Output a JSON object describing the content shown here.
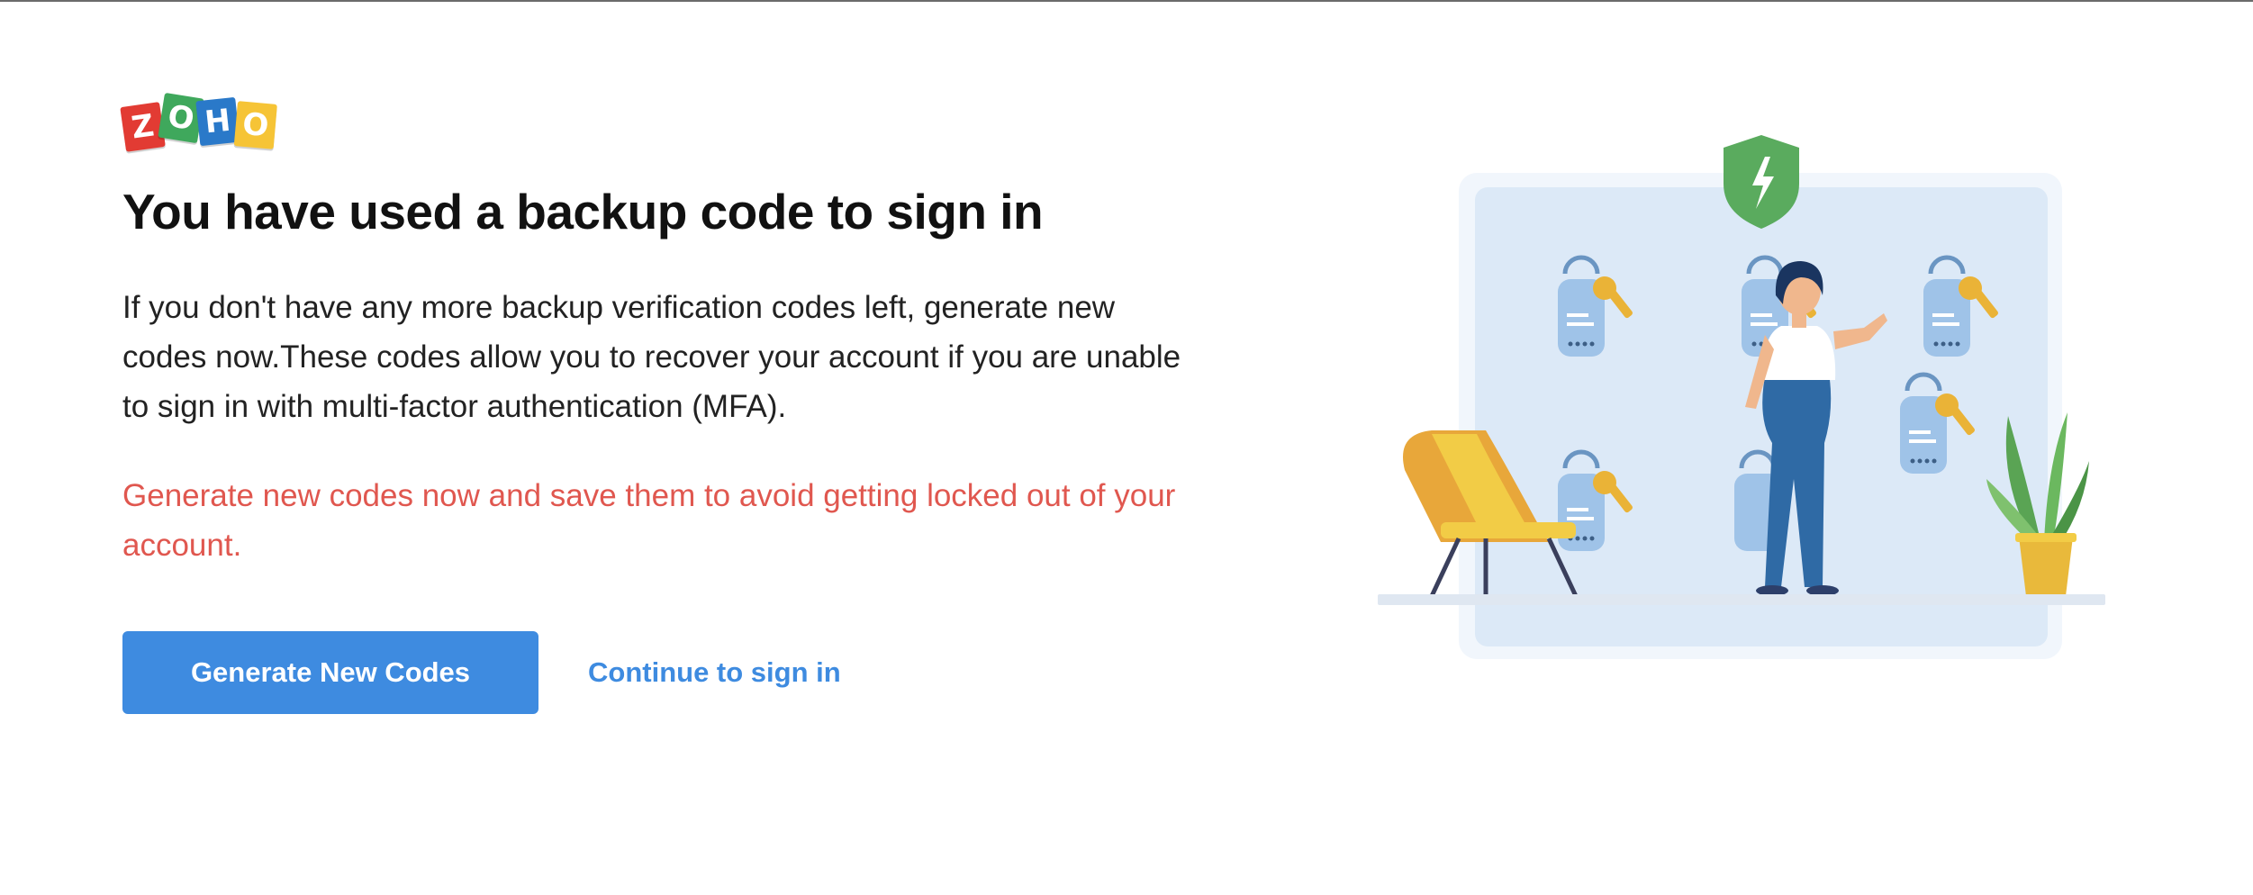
{
  "logo": {
    "letters": [
      "Z",
      "O",
      "H",
      "O"
    ]
  },
  "title": "You have used a backup code to sign in",
  "description": "If you don't have any more backup verification codes left, generate new codes now.These codes allow you to recover your account if you are unable to sign in with multi-factor authentication (MFA).",
  "warning": "Generate new codes now and save them to avoid getting locked out of your account.",
  "actions": {
    "generate_label": "Generate New Codes",
    "continue_label": "Continue to sign in"
  },
  "colors": {
    "primary": "#3e8be0",
    "warning": "#e0574f",
    "title": "#111111"
  },
  "illustration": {
    "icon_names": [
      "shield-icon",
      "lock-icon",
      "key-icon",
      "chair-icon",
      "plant-icon",
      "woman-figure"
    ]
  }
}
